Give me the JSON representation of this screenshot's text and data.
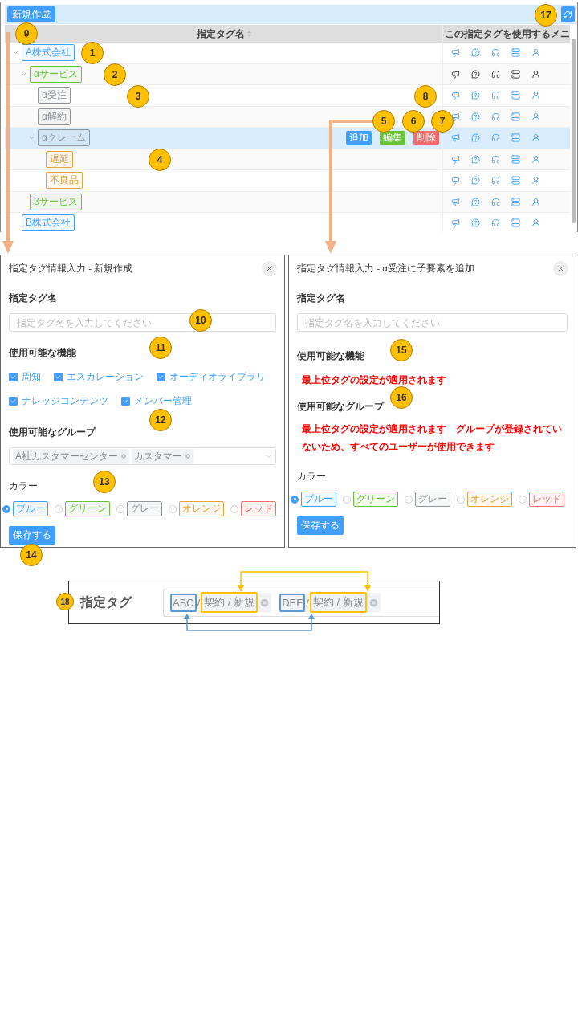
{
  "toolbar": {
    "new_button": "新規作成"
  },
  "table": {
    "columns": [
      "指定タグ名",
      "この指定タグを使用するメニ"
    ],
    "row_actions": [
      {
        "kind": "add",
        "label": "追加"
      },
      {
        "kind": "edit",
        "label": "編集"
      },
      {
        "kind": "delete",
        "label": "削除"
      }
    ],
    "rows": [
      {
        "label": "A株式会社",
        "color": "#409eff",
        "expanded": true,
        "selected": false,
        "menu_icons_emphasized": false,
        "children": [
          {
            "label": "αサービス",
            "color": "#67c23a",
            "expanded": true,
            "selected": false,
            "menu_icons_emphasized": true,
            "children": [
              {
                "label": "α受注",
                "color": "#909399",
                "selected": false,
                "menu_icons_emphasized": false
              },
              {
                "label": "α解約",
                "color": "#909399",
                "selected": false,
                "menu_icons_emphasized": false
              },
              {
                "label": "αクレーム",
                "color": "#909399",
                "expanded": true,
                "selected": true,
                "menu_icons_emphasized": false,
                "children": [
                  {
                    "label": "遅延",
                    "color": "#e6a23c",
                    "selected": false,
                    "menu_icons_emphasized": false
                  },
                  {
                    "label": "不良品",
                    "color": "#e6a23c",
                    "selected": false,
                    "menu_icons_emphasized": false
                  }
                ]
              }
            ]
          },
          {
            "label": "βサービス",
            "color": "#67c23a",
            "selected": false,
            "menu_icons_emphasized": false
          }
        ]
      },
      {
        "label": "B株式会社",
        "color": "#409eff",
        "selected": false,
        "menu_icons_emphasized": false
      }
    ]
  },
  "dialogs": [
    {
      "title": "指定タグ情報入力 - 新規作成",
      "sections": [
        {
          "kind": "input",
          "label": "指定タグ名",
          "placeholder": "指定タグ名を入力してください"
        },
        {
          "kind": "checkboxes",
          "label": "使用可能な機能",
          "items": [
            {
              "label": "周知",
              "checked": true
            },
            {
              "label": "エスカレーション",
              "checked": true
            },
            {
              "label": "オーディオライブラリ",
              "checked": true
            },
            {
              "label": "ナレッジコンテンツ",
              "checked": true
            },
            {
              "label": "メンバー管理",
              "checked": true
            }
          ]
        },
        {
          "kind": "select",
          "label": "使用可能なグループ",
          "chips": [
            "A社カスタマーセンター",
            "カスタマー"
          ]
        },
        {
          "kind": "colors",
          "label": "カラー",
          "options": [
            {
              "label": "ブルー",
              "color": "#409eff",
              "selected": true
            },
            {
              "label": "グリーン",
              "color": "#67c23a",
              "selected": false
            },
            {
              "label": "グレー",
              "color": "#909399",
              "selected": false
            },
            {
              "label": "オレンジ",
              "color": "#e6a23c",
              "selected": false
            },
            {
              "label": "レッド",
              "color": "#f56c6c",
              "selected": false
            }
          ]
        }
      ],
      "save_button": "保存する"
    },
    {
      "title": "指定タグ情報入力 - α受注に子要素を追加",
      "sections": [
        {
          "kind": "input",
          "label": "指定タグ名",
          "placeholder": "指定タグ名を入力してください"
        },
        {
          "kind": "notice",
          "label": "使用可能な機能",
          "text": "最上位タグの設定が適用されます"
        },
        {
          "kind": "notice",
          "label": "使用可能なグループ",
          "text": "最上位タグの設定が適用されます　グループが登録されていないため、すべてのユーザーが使用できます"
        },
        {
          "kind": "colors",
          "label": "カラー",
          "options": [
            {
              "label": "ブルー",
              "color": "#409eff",
              "selected": true
            },
            {
              "label": "グリーン",
              "color": "#67c23a",
              "selected": false
            },
            {
              "label": "グレー",
              "color": "#909399",
              "selected": false
            },
            {
              "label": "オレンジ",
              "color": "#e6a23c",
              "selected": false
            },
            {
              "label": "レッド",
              "color": "#f56c6c",
              "selected": false
            }
          ]
        }
      ],
      "save_button": "保存する"
    }
  ],
  "tag_diagram": {
    "label": "指定タグ",
    "chips": [
      {
        "code": "ABC",
        "separator": "/",
        "path": "契約 / 新規"
      },
      {
        "code": "DEF",
        "separator": "/",
        "path": "契約 / 新規"
      }
    ]
  },
  "callouts": [
    "1",
    "2",
    "3",
    "4",
    "5",
    "6",
    "7",
    "8",
    "9",
    "10",
    "11",
    "12",
    "13",
    "14",
    "15",
    "16",
    "17",
    "18"
  ]
}
